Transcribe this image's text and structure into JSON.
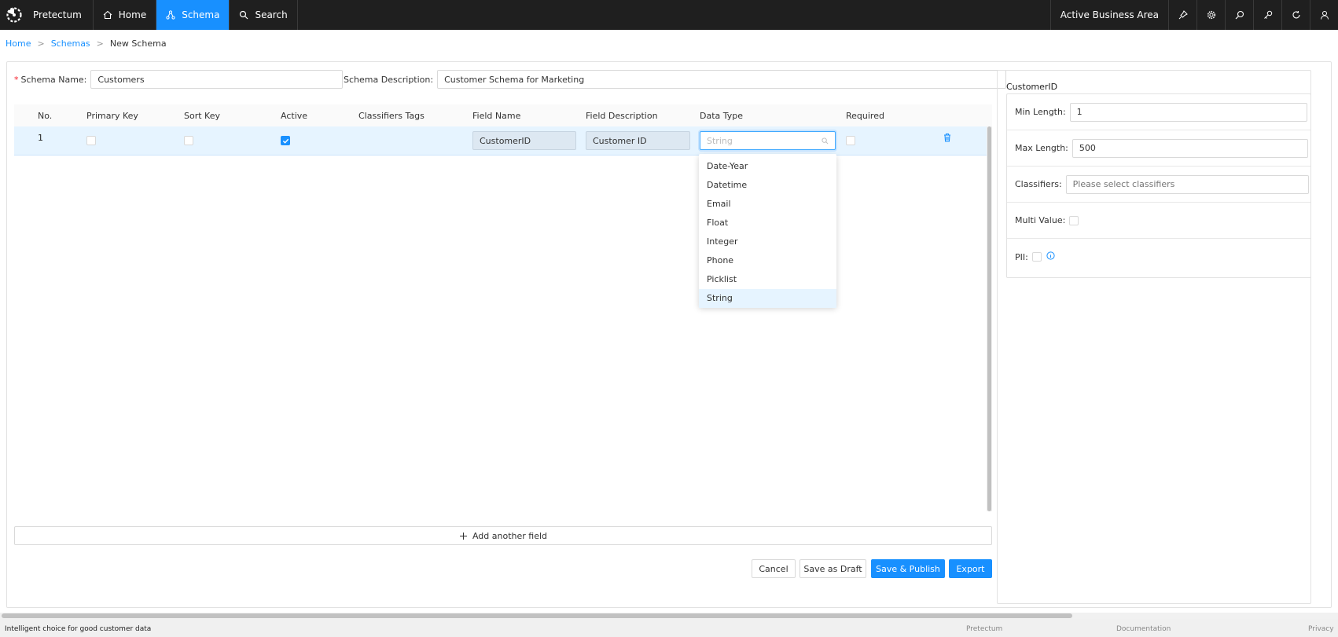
{
  "app": {
    "brand": "Pretectum"
  },
  "nav": {
    "items": [
      {
        "label": "Home",
        "icon": "home-icon",
        "active": false
      },
      {
        "label": "Schema",
        "icon": "schema-icon",
        "active": true
      },
      {
        "label": "Search",
        "icon": "search-icon",
        "active": false
      }
    ],
    "business_area": "Active Business Area",
    "right_icons": [
      "pin-icon",
      "gear-icon",
      "zoom-icon",
      "key-icon",
      "refresh-icon",
      "user-icon"
    ]
  },
  "breadcrumb": {
    "home": "Home",
    "schemas": "Schemas",
    "current": "New Schema",
    "separator": ">"
  },
  "form": {
    "schema_name_label": "Schema Name:",
    "schema_name_value": "Customers",
    "schema_desc_label": "Schema Description:",
    "schema_desc_value": "Customer Schema for Marketing",
    "required_mark": "*"
  },
  "table": {
    "headers": {
      "no": "No.",
      "primary_key": "Primary Key",
      "sort_key": "Sort Key",
      "active": "Active",
      "classifiers": "Classifiers Tags",
      "field_name": "Field Name",
      "field_desc": "Field Description",
      "data_type": "Data Type",
      "required": "Required"
    },
    "rows": [
      {
        "no": "1",
        "primary_key": false,
        "sort_key": false,
        "active": true,
        "field_name": "CustomerID",
        "field_desc": "Customer ID",
        "data_type_placeholder": "String",
        "required": false
      }
    ]
  },
  "dropdown": {
    "options": [
      "Date-Year",
      "Datetime",
      "Email",
      "Float",
      "Integer",
      "Phone",
      "Picklist",
      "String"
    ],
    "selected": "String"
  },
  "add_field_label": "Add another field",
  "buttons": {
    "cancel": "Cancel",
    "draft": "Save as Draft",
    "publish": "Save & Publish",
    "export": "Export"
  },
  "properties": {
    "title": "CustomerID",
    "min_length_label": "Min Length:",
    "min_length_value": "1",
    "max_length_label": "Max Length:",
    "max_length_value": "500",
    "classifiers_label": "Classifiers:",
    "classifiers_placeholder": "Please select classifiers",
    "multi_value_label": "Multi Value:",
    "pii_label": "PII:"
  },
  "footer": {
    "tagline": "Intelligent choice for good customer data",
    "links": [
      "Pretectum",
      "Documentation",
      "Privacy"
    ]
  },
  "colors": {
    "accent": "#1890ff",
    "topbar": "#1f1f1f",
    "row_highlight": "#e6f4ff",
    "required": "#f5222d"
  }
}
